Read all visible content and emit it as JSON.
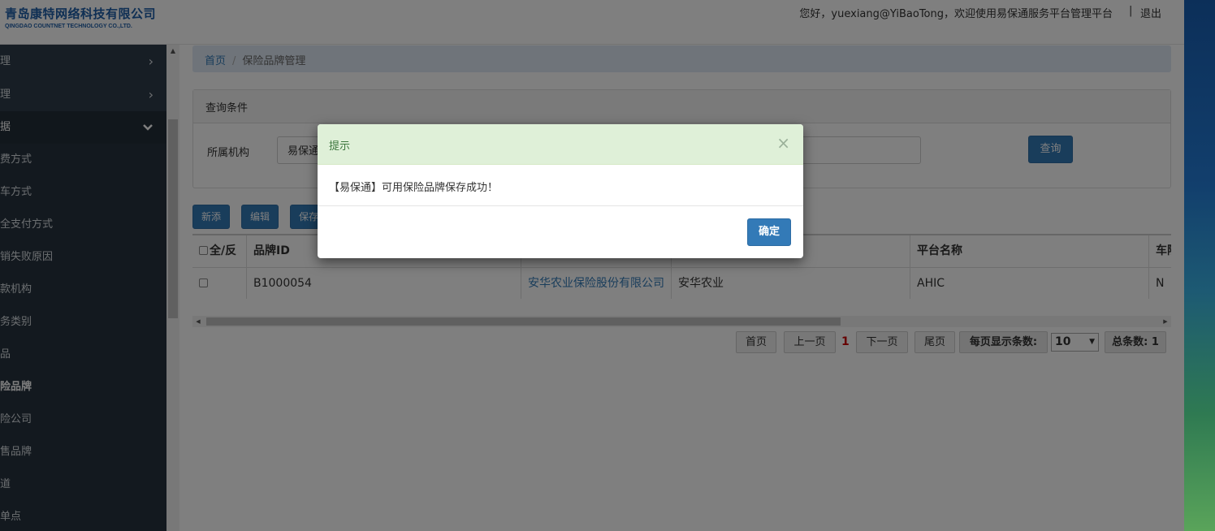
{
  "header": {
    "logo_cn": "青岛康特网络科技有限公司",
    "logo_en": "QINGDAO COUNTNET TECHNOLOGY CO.,LTD.",
    "welcome": "您好，yuexiang@YiBaoTong，欢迎使用易保通服务平台管理平台",
    "logout_sep": "|",
    "logout": "退出"
  },
  "sidebar": {
    "items": [
      {
        "label": "理",
        "chevron": "›"
      },
      {
        "label": "理",
        "chevron": "›"
      },
      {
        "label": "据",
        "chevron": "⌄"
      }
    ],
    "sub_items": [
      "费方式",
      "车方式",
      "全支付方式",
      "销失败原因",
      "款机构",
      "务类别",
      "品",
      "险品牌",
      "险公司",
      "售品牌",
      "道",
      "单点"
    ]
  },
  "breadcrumb": {
    "home": "首页",
    "sep": "/",
    "current": "保险品牌管理"
  },
  "query_panel": {
    "title": "查询条件",
    "org_label": "所属机构",
    "org_value": "易保通",
    "search_button": "查询"
  },
  "toolbar": {
    "add": "新添",
    "edit": "编辑",
    "save": "保存"
  },
  "table": {
    "headers": [
      "全/反",
      "品牌ID",
      "",
      "",
      "平台名称",
      "车险"
    ],
    "rows": [
      {
        "brand_id": "B1000054",
        "company": "安华农业保险股份有限公司",
        "short_name": "安华农业",
        "platform_name": "AHIC",
        "flag": "N"
      }
    ]
  },
  "pagination": {
    "first": "首页",
    "prev": "上一页",
    "current": "1",
    "next": "下一页",
    "last": "尾页",
    "page_size_label": "每页显示条数:",
    "page_size": "10",
    "total": "总条数: 1"
  },
  "modal": {
    "title": "提示",
    "close": "×",
    "message": "【易保通】可用保险品牌保存成功！",
    "ok": "确定"
  },
  "colors": {
    "primary": "#337ab7",
    "sidebar_bg": "#2f3d4a",
    "modal_header_bg": "#dff0d8",
    "modal_title": "#3c763d",
    "page_current": "#cc0000"
  }
}
